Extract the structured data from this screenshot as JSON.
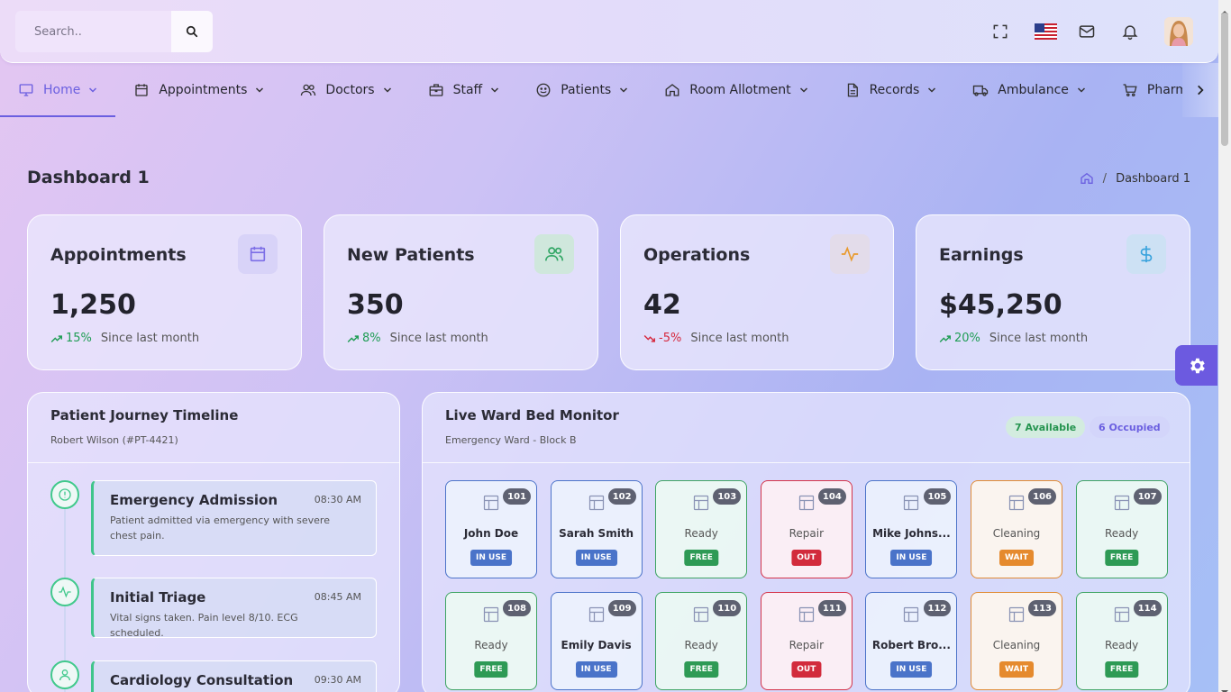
{
  "search": {
    "placeholder": "Search.."
  },
  "nav": {
    "items": [
      {
        "label": "Home",
        "icon": "monitor-icon",
        "active": true
      },
      {
        "label": "Appointments",
        "icon": "calendar-icon"
      },
      {
        "label": "Doctors",
        "icon": "users-icon"
      },
      {
        "label": "Staff",
        "icon": "briefcase-icon"
      },
      {
        "label": "Patients",
        "icon": "smile-icon"
      },
      {
        "label": "Room Allotment",
        "icon": "home-icon"
      },
      {
        "label": "Records",
        "icon": "file-icon"
      },
      {
        "label": "Ambulance",
        "icon": "truck-icon"
      },
      {
        "label": "Pharmacy",
        "icon": "cart-icon"
      }
    ]
  },
  "page": {
    "title": "Dashboard 1",
    "breadcrumb_current": "Dashboard 1"
  },
  "stats": [
    {
      "title": "Appointments",
      "value": "1,250",
      "change": "15%",
      "direction": "up",
      "since": "Since last month",
      "icon": "calendar-icon",
      "accent": "#7c6ee6"
    },
    {
      "title": "New Patients",
      "value": "350",
      "change": "8%",
      "direction": "up",
      "since": "Since last month",
      "icon": "users-icon",
      "accent": "#2fa563"
    },
    {
      "title": "Operations",
      "value": "42",
      "change": "-5%",
      "direction": "down",
      "since": "Since last month",
      "icon": "activity-icon",
      "accent": "#e99a2c"
    },
    {
      "title": "Earnings",
      "value": "$45,250",
      "change": "20%",
      "direction": "up",
      "since": "Since last month",
      "icon": "dollar-icon",
      "accent": "#3aa3dd"
    }
  ],
  "timeline": {
    "title": "Patient Journey Timeline",
    "subtitle": "Robert Wilson (#PT-4421)",
    "events": [
      {
        "title": "Emergency Admission",
        "time": "08:30 AM",
        "desc": "Patient admitted via emergency with severe chest pain.",
        "icon": "alert-circle-icon"
      },
      {
        "title": "Initial Triage",
        "time": "08:45 AM",
        "desc": "Vital signs taken. Pain level 8/10. ECG scheduled.",
        "icon": "activity-icon"
      },
      {
        "title": "Cardiology Consultation",
        "time": "09:30 AM",
        "desc": "",
        "icon": "user-icon"
      }
    ]
  },
  "ward": {
    "title": "Live Ward Bed Monitor",
    "subtitle": "Emergency Ward - Block B",
    "available": "7 Available",
    "occupied": "6 Occupied",
    "beds": [
      {
        "num": "101",
        "name": "John Doe",
        "status": "IN USE",
        "kind": "occ"
      },
      {
        "num": "102",
        "name": "Sarah Smith",
        "status": "IN USE",
        "kind": "occ"
      },
      {
        "num": "103",
        "name": "Ready",
        "status": "FREE",
        "kind": "free"
      },
      {
        "num": "104",
        "name": "Repair",
        "status": "OUT",
        "kind": "out"
      },
      {
        "num": "105",
        "name": "Mike Johns...",
        "status": "IN USE",
        "kind": "occ"
      },
      {
        "num": "106",
        "name": "Cleaning",
        "status": "WAIT",
        "kind": "wait"
      },
      {
        "num": "107",
        "name": "Ready",
        "status": "FREE",
        "kind": "free"
      },
      {
        "num": "108",
        "name": "Ready",
        "status": "FREE",
        "kind": "free"
      },
      {
        "num": "109",
        "name": "Emily Davis",
        "status": "IN USE",
        "kind": "occ"
      },
      {
        "num": "110",
        "name": "Ready",
        "status": "FREE",
        "kind": "free"
      },
      {
        "num": "111",
        "name": "Repair",
        "status": "OUT",
        "kind": "out"
      },
      {
        "num": "112",
        "name": "Robert Bro...",
        "status": "IN USE",
        "kind": "occ"
      },
      {
        "num": "113",
        "name": "Cleaning",
        "status": "WAIT",
        "kind": "wait"
      },
      {
        "num": "114",
        "name": "Ready",
        "status": "FREE",
        "kind": "free"
      }
    ]
  },
  "colors": {
    "primary": "#6b5fe0",
    "success": "#2e9a55",
    "danger": "#d22b3c",
    "warning": "#e58a2e",
    "info": "#4a73c9"
  }
}
